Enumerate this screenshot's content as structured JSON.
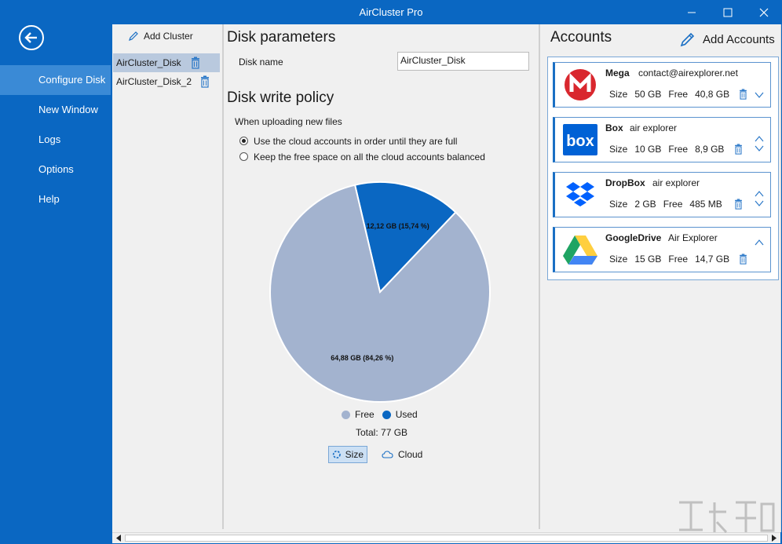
{
  "window": {
    "title": "AirCluster Pro",
    "minimize": "—",
    "maximize": "☐",
    "close": "✕"
  },
  "sidebar": {
    "back_icon": "back-arrow-icon",
    "items": [
      {
        "label": "Configure Disk",
        "active": true
      },
      {
        "label": "New Window",
        "active": false
      },
      {
        "label": "Logs",
        "active": false
      },
      {
        "label": "Options",
        "active": false
      },
      {
        "label": "Help",
        "active": false
      }
    ]
  },
  "clusters": {
    "add_label": "Add Cluster",
    "items": [
      {
        "name": "AirCluster_Disk",
        "selected": true
      },
      {
        "name": "AirCluster_Disk_2",
        "selected": false
      }
    ]
  },
  "disk": {
    "params_heading": "Disk parameters",
    "name_label": "Disk name",
    "name_value": "AirCluster_Disk",
    "policy_heading": "Disk write policy",
    "policy_subheading": "When uploading new files",
    "options": [
      {
        "label": "Use the cloud accounts in order until they are full",
        "checked": true
      },
      {
        "label": "Keep the free space on all the cloud accounts balanced",
        "checked": false
      }
    ]
  },
  "chart_data": {
    "type": "pie",
    "slices": [
      {
        "name": "Used",
        "value": 12.12,
        "percent": 15.74,
        "label": "12,12 GB (15,74 %)",
        "color": "#0a67c2"
      },
      {
        "name": "Free",
        "value": 64.88,
        "percent": 84.26,
        "label": "64,88 GB (84,26 %)",
        "color": "#a3b3cf"
      }
    ],
    "legend": [
      "Free",
      "Used"
    ],
    "total_label": "Total: 77 GB"
  },
  "view_toggle": {
    "size_label": "Size",
    "cloud_label": "Cloud",
    "selected": "Size"
  },
  "accounts": {
    "heading": "Accounts",
    "add_label": "Add Accounts",
    "items": [
      {
        "service": "Mega",
        "user": "contact@airexplorer.net",
        "size_label": "Size",
        "size": "50 GB",
        "free_label": "Free",
        "free": "40,8 GB",
        "logo": "mega-logo-icon",
        "brand_color": "#d9272e"
      },
      {
        "service": "Box",
        "user": "air explorer",
        "size_label": "Size",
        "size": "10 GB",
        "free_label": "Free",
        "free": "8,9 GB",
        "logo": "box-logo-icon",
        "brand_color": "#0061d5"
      },
      {
        "service": "DropBox",
        "user": "air explorer",
        "size_label": "Size",
        "size": "2 GB",
        "free_label": "Free",
        "free": "485 MB",
        "logo": "dropbox-logo-icon",
        "brand_color": "#0061fe"
      },
      {
        "service": "GoogleDrive",
        "user": "Air Explorer",
        "size_label": "Size",
        "size": "15 GB",
        "free_label": "Free",
        "free": "14,7 GB",
        "logo": "google-drive-logo-icon",
        "brand_color": "#1fa463"
      }
    ]
  },
  "colors": {
    "accent": "#0a67c2",
    "nav_active": "#3a8ad6",
    "used": "#0a67c2",
    "free": "#a3b3cf"
  }
}
